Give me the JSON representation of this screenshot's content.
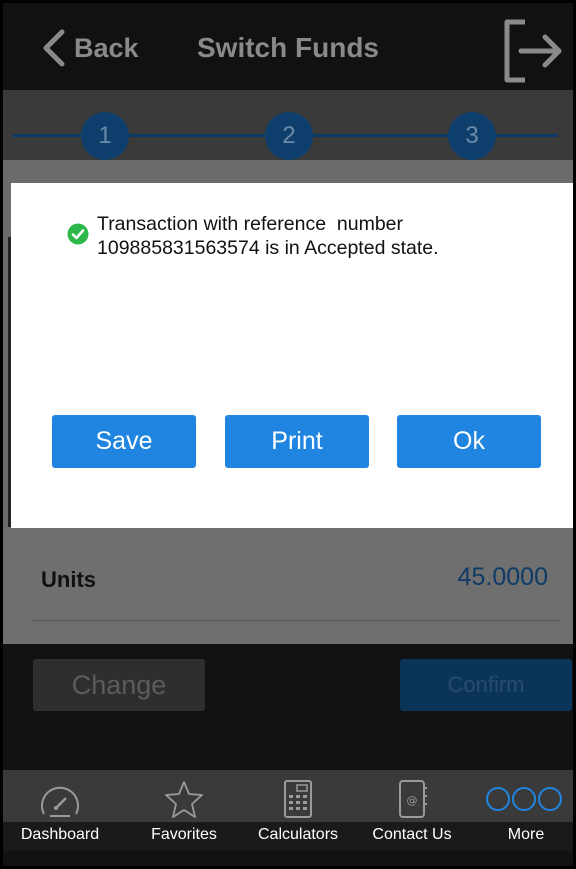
{
  "header": {
    "back_label": "Back",
    "title": "Switch Funds",
    "logout_icon": "logout-icon"
  },
  "steps": [
    "1",
    "2",
    "3"
  ],
  "form": {
    "units_label": "Units",
    "units_value": "45.0000"
  },
  "actions": {
    "change_label": "Change",
    "confirm_label": "Confirm"
  },
  "dialog": {
    "message_line1": "Transaction with reference  number",
    "message_line2": "109885831563574 is in Accepted state.",
    "status_icon": "check-circle-icon",
    "buttons": {
      "save": "Save",
      "print": "Print",
      "ok": "Ok"
    }
  },
  "tabbar": {
    "items": [
      {
        "label": "Dashboard",
        "icon": "speedometer-icon"
      },
      {
        "label": "Favorites",
        "icon": "star-icon"
      },
      {
        "label": "Calculators",
        "icon": "calculator-icon"
      },
      {
        "label": "Contact Us",
        "icon": "address-book-icon"
      },
      {
        "label": "More",
        "icon": "more-icon"
      }
    ]
  },
  "colors": {
    "accent": "#1f85e0",
    "success": "#2db84b",
    "header_text": "#8a8a8a"
  }
}
